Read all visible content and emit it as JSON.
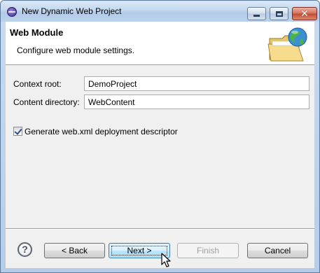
{
  "window": {
    "title": "New Dynamic Web Project"
  },
  "header": {
    "title": "Web Module",
    "description": "Configure web module settings."
  },
  "form": {
    "context_root": {
      "label": "Context root:",
      "value": "DemoProject"
    },
    "content_directory": {
      "label": "Content directory:",
      "value": "WebContent"
    },
    "generate_descriptor": {
      "label": "Generate web.xml deployment descriptor",
      "checked": true
    }
  },
  "buttons": {
    "help": "?",
    "back": "< Back",
    "next": "Next >",
    "finish": "Finish",
    "cancel": "Cancel"
  },
  "icons": {
    "app": "eclipse-icon",
    "minimize": "minimize-icon",
    "maximize": "maximize-icon",
    "close": "close-icon",
    "wizard": "folder-globe-icon",
    "help": "help-icon",
    "cursor": "mouse-pointer-icon"
  },
  "colors": {
    "title_bar": "#c4d8ef",
    "close_button": "#c14a30",
    "default_button_border": "#3c7fb1"
  },
  "state": {
    "finish_enabled": false,
    "default_button": "next"
  }
}
